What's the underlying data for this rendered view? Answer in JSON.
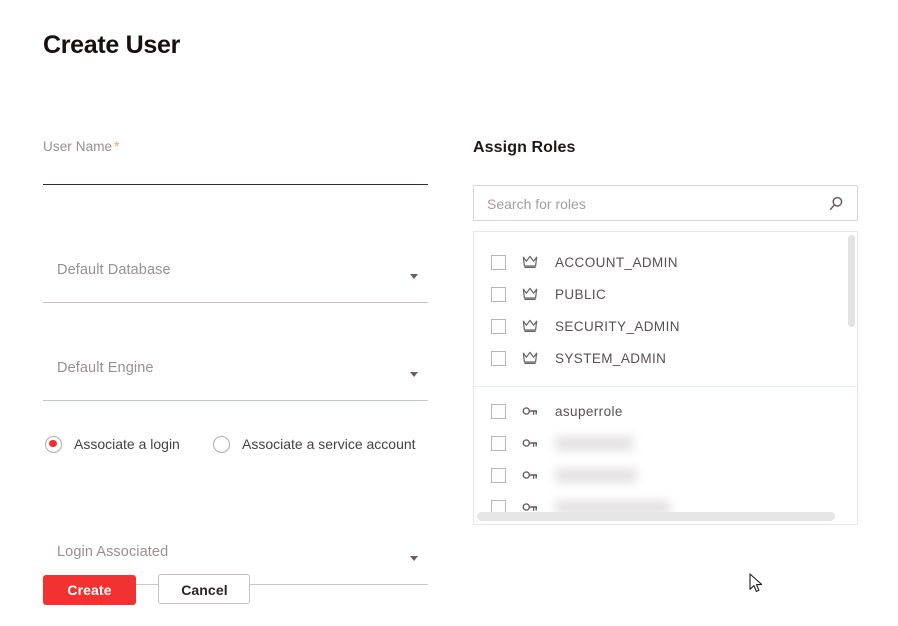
{
  "page": {
    "title": "Create User"
  },
  "form": {
    "user_name": {
      "label": "User Name",
      "required_mark": "*",
      "value": ""
    },
    "default_database": {
      "placeholder": "Default Database",
      "value": ""
    },
    "default_engine": {
      "placeholder": "Default Engine",
      "value": ""
    },
    "association": {
      "options": [
        {
          "label": "Associate a login",
          "selected": true
        },
        {
          "label": "Associate a service account",
          "selected": false
        }
      ]
    },
    "login_associated": {
      "placeholder": "Login Associated",
      "value": ""
    }
  },
  "actions": {
    "create_label": "Create",
    "cancel_label": "Cancel"
  },
  "roles": {
    "title": "Assign Roles",
    "search_placeholder": "Search for roles",
    "search_value": "",
    "search_icon": "search-icon",
    "system_roles": [
      {
        "name": "ACCOUNT_ADMIN",
        "icon": "crown-icon",
        "checked": false,
        "redacted": false
      },
      {
        "name": "PUBLIC",
        "icon": "crown-icon",
        "checked": false,
        "redacted": false
      },
      {
        "name": "SECURITY_ADMIN",
        "icon": "crown-icon",
        "checked": false,
        "redacted": false
      },
      {
        "name": "SYSTEM_ADMIN",
        "icon": "crown-icon",
        "checked": false,
        "redacted": false
      }
    ],
    "custom_roles": [
      {
        "name": "asuperrole",
        "icon": "key-icon",
        "checked": false,
        "redacted": false
      },
      {
        "name": "",
        "icon": "key-icon",
        "checked": false,
        "redacted": true
      },
      {
        "name": "",
        "icon": "key-icon",
        "checked": false,
        "redacted": true
      },
      {
        "name": "",
        "icon": "key-icon",
        "checked": false,
        "redacted": true
      }
    ]
  },
  "colors": {
    "primary_red": "#f23131",
    "radio_red": "#f2302f",
    "required_star": "#f4a06a",
    "text_dark": "#1a0f0f",
    "text_muted": "#9b8f8f",
    "border_light": "#ddd4d4"
  }
}
